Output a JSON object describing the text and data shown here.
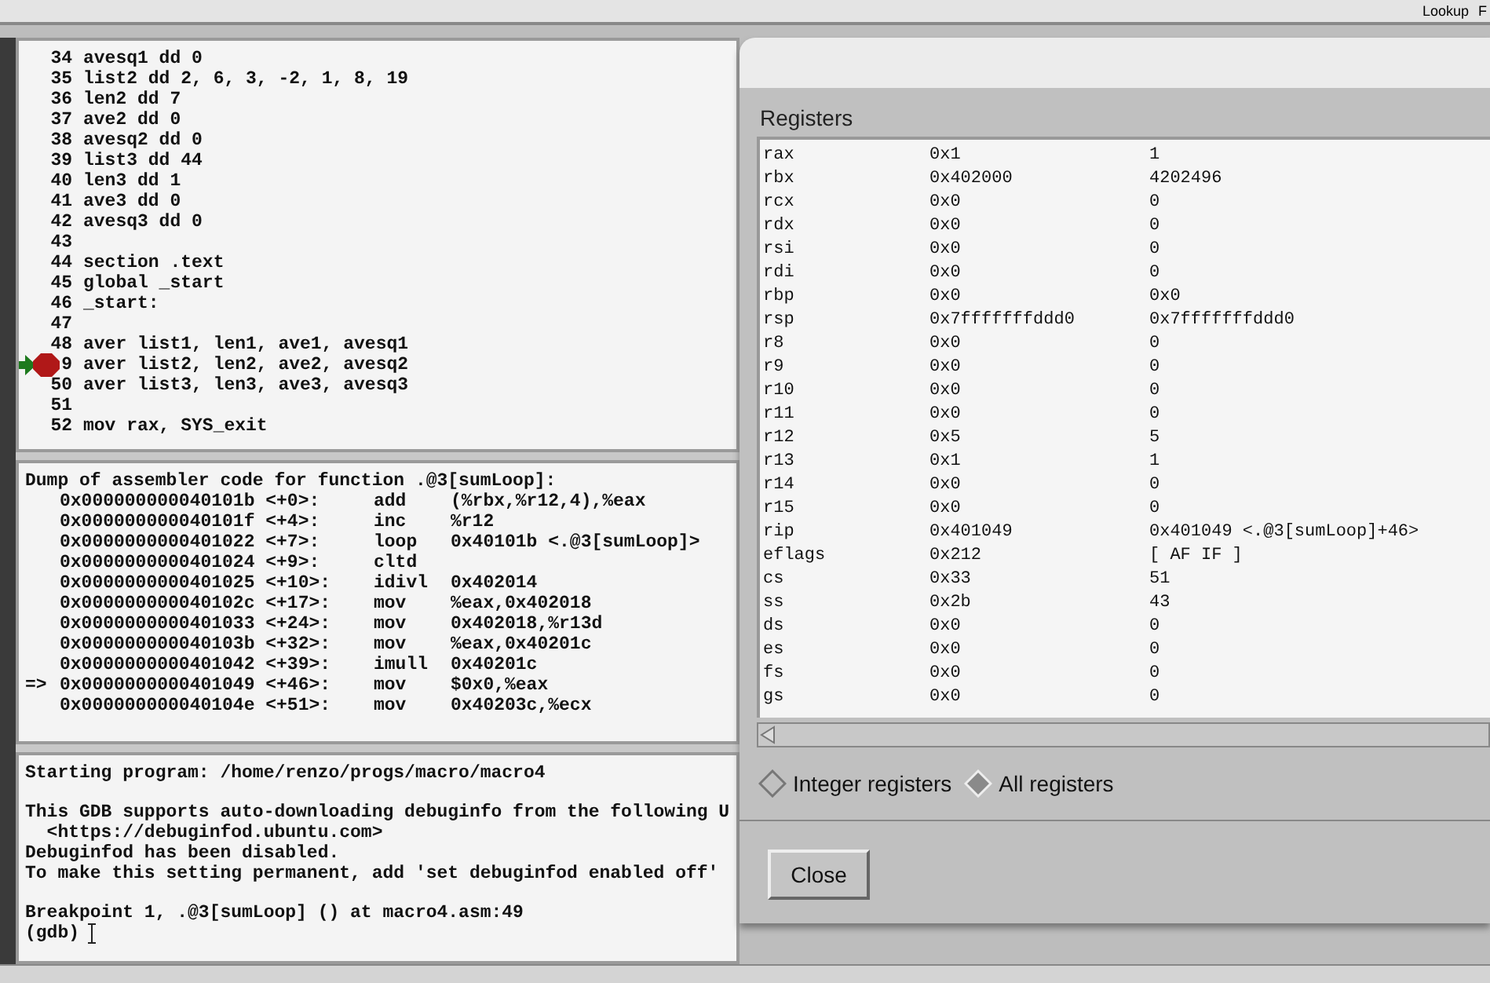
{
  "toolbar": {
    "buttons": [
      "Lookup",
      "F"
    ]
  },
  "source": {
    "lines": [
      {
        "number": "34",
        "code": "avesq1 dd 0",
        "breakpoint": false,
        "current": false
      },
      {
        "number": "35",
        "code": "list2 dd 2, 6, 3, -2, 1, 8, 19",
        "breakpoint": false,
        "current": false
      },
      {
        "number": "36",
        "code": "len2 dd 7",
        "breakpoint": false,
        "current": false
      },
      {
        "number": "37",
        "code": "ave2 dd 0",
        "breakpoint": false,
        "current": false
      },
      {
        "number": "38",
        "code": "avesq2 dd 0",
        "breakpoint": false,
        "current": false
      },
      {
        "number": "39",
        "code": "list3 dd 44",
        "breakpoint": false,
        "current": false
      },
      {
        "number": "40",
        "code": "len3 dd 1",
        "breakpoint": false,
        "current": false
      },
      {
        "number": "41",
        "code": "ave3 dd 0",
        "breakpoint": false,
        "current": false
      },
      {
        "number": "42",
        "code": "avesq3 dd 0",
        "breakpoint": false,
        "current": false
      },
      {
        "number": "43",
        "breakpoint": false,
        "current": false
      },
      {
        "number": "44",
        "code": "section .text",
        "breakpoint": false,
        "current": false
      },
      {
        "number": "45",
        "code": "global _start",
        "breakpoint": false,
        "current": false
      },
      {
        "number": "46",
        "code": "_start:",
        "breakpoint": false,
        "current": false
      },
      {
        "number": "47",
        "breakpoint": false,
        "current": false
      },
      {
        "number": "48",
        "code": "aver list1, len1, ave1, avesq1",
        "breakpoint": false,
        "current": false
      },
      {
        "number": "9",
        "code": "aver list2, len2, ave2, avesq2",
        "breakpoint": true,
        "current": true
      },
      {
        "number": "50",
        "code": "aver list3, len3, ave3, avesq3",
        "breakpoint": false,
        "current": false
      },
      {
        "number": "51",
        "breakpoint": false,
        "current": false
      },
      {
        "number": "52",
        "code": "mov rax, SYS_exit",
        "breakpoint": false,
        "current": false
      }
    ]
  },
  "disassembly": {
    "header": "Dump of assembler code for function .@3[sumLoop]:",
    "rows": [
      {
        "address": "0x000000000040101b <+0>:",
        "op": "add",
        "args": "(%rbx,%r12,4),%eax"
      },
      {
        "address": "0x000000000040101f <+4>:",
        "op": "inc",
        "args": "%r12"
      },
      {
        "address": "0x0000000000401022 <+7>:",
        "op": "loop",
        "args": "0x40101b <.@3[sumLoop]>"
      },
      {
        "address": "0x0000000000401024 <+9>:",
        "op": "cltd"
      },
      {
        "address": "0x0000000000401025 <+10>:",
        "op": "idivl",
        "args": "0x402014"
      },
      {
        "address": "0x000000000040102c <+17>:",
        "op": "mov",
        "args": "%eax,0x402018"
      },
      {
        "address": "0x0000000000401033 <+24>:",
        "op": "mov",
        "args": "0x402018,%r13d"
      },
      {
        "address": "0x000000000040103b <+32>:",
        "op": "mov",
        "args": "%eax,0x40201c"
      },
      {
        "address": "0x0000000000401042 <+39>:",
        "op": "imull",
        "args": "0x40201c"
      },
      {
        "marker": "=>",
        "address": "0x0000000000401049 <+46>:",
        "op": "mov",
        "args": "$0x0,%eax"
      },
      {
        "address": "0x000000000040104e <+51>:",
        "op": "mov",
        "args": "0x40203c,%ecx"
      }
    ]
  },
  "console": {
    "blocks": [
      [
        "Starting program: /home/renzo/progs/macro/macro4"
      ],
      [
        "This GDB supports auto-downloading debuginfo from the following U",
        "  <https://debuginfod.ubuntu.com>",
        "Debuginfod has been disabled.",
        "To make this setting permanent, add 'set debuginfod enabled off'"
      ],
      [
        "Breakpoint 1, .@3[sumLoop] () at macro4.asm:49"
      ]
    ],
    "prompt": "(gdb)"
  },
  "registers_dialog": {
    "title": "Registers",
    "rows": [
      [
        "rax",
        "0x1",
        "1"
      ],
      [
        "rbx",
        "0x402000",
        "4202496"
      ],
      [
        "rcx",
        "0x0",
        "0"
      ],
      [
        "rdx",
        "0x0",
        "0"
      ],
      [
        "rsi",
        "0x0",
        "0"
      ],
      [
        "rdi",
        "0x0",
        "0"
      ],
      [
        "rbp",
        "0x0",
        "0x0"
      ],
      [
        "rsp",
        "0x7fffffffddd0",
        "0x7fffffffddd0"
      ],
      [
        "r8",
        "0x0",
        "0"
      ],
      [
        "r9",
        "0x0",
        "0"
      ],
      [
        "r10",
        "0x0",
        "0"
      ],
      [
        "r11",
        "0x0",
        "0"
      ],
      [
        "r12",
        "0x5",
        "5"
      ],
      [
        "r13",
        "0x1",
        "1"
      ],
      [
        "r14",
        "0x0",
        "0"
      ],
      [
        "r15",
        "0x0",
        "0"
      ],
      [
        "rip",
        "0x401049",
        "0x401049 <.@3[sumLoop]+46>"
      ],
      [
        "eflags",
        "0x212",
        "[ AF IF ]"
      ],
      [
        "cs",
        "0x33",
        "51"
      ],
      [
        "ss",
        "0x2b",
        "43"
      ],
      [
        "ds",
        "0x0",
        "0"
      ],
      [
        "es",
        "0x0",
        "0"
      ],
      [
        "fs",
        "0x0",
        "0"
      ],
      [
        "gs",
        "0x0",
        "0"
      ]
    ],
    "options": [
      {
        "label": "Integer registers",
        "selected": false
      },
      {
        "label": "All registers",
        "selected": true
      }
    ],
    "close_button": "Close"
  }
}
